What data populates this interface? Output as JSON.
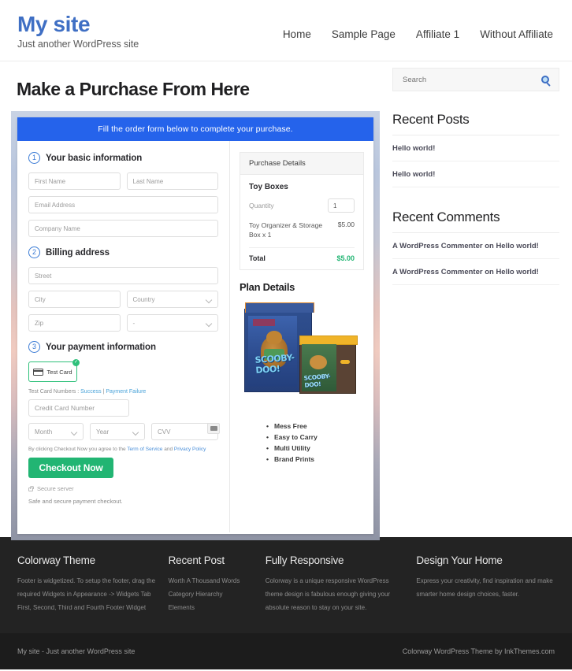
{
  "header": {
    "site_title": "My site",
    "tagline": "Just another WordPress site",
    "nav": [
      {
        "label": "Home"
      },
      {
        "label": "Sample Page"
      },
      {
        "label": "Affiliate 1"
      },
      {
        "label": "Without Affiliate"
      }
    ]
  },
  "main": {
    "page_title": "Make a Purchase From Here",
    "form_banner": "Fill the order form below to complete your purchase.",
    "steps": {
      "basic": {
        "num": "1",
        "label": "Your basic information"
      },
      "billing": {
        "num": "2",
        "label": "Billing address"
      },
      "payment": {
        "num": "3",
        "label": "Your payment information"
      }
    },
    "fields": {
      "first_name": "First Name",
      "last_name": "Last Name",
      "email": "Email Address",
      "company": "Company Name",
      "street": "Street",
      "city": "City",
      "country": "Country",
      "zip": "Zip",
      "state": "-",
      "credit_card": "Credit Card Number",
      "month": "Month",
      "year": "Year",
      "cvv": "CVV"
    },
    "payment_method": {
      "label": "Test Card",
      "check_glyph": "✓"
    },
    "test_card": {
      "prefix": "Test Card Numbers : ",
      "success": "Success",
      "separator": " | ",
      "failure": "Payment Failure"
    },
    "terms": {
      "prefix": "By clicking Checkout Now you agree to the ",
      "tos": "Term of Service",
      "middle": " and ",
      "privacy": "Privacy Policy"
    },
    "checkout_button": "Checkout Now",
    "secure_server": "Secure server",
    "safe_text": "Safe and secure payment checkout."
  },
  "purchase": {
    "panel_title": "Purchase Details",
    "product_name": "Toy Boxes",
    "quantity_label": "Quantity",
    "quantity_value": "1",
    "line_item_name": "Toy Organizer & Storage Box x 1",
    "line_item_price": "$5.00",
    "total_label": "Total",
    "total_value": "$5.00",
    "plan_title": "Plan Details",
    "product_brand": "SCOOBY-DOO!",
    "features": [
      "Mess Free",
      "Easy to Carry",
      "Multi Utility",
      "Brand Prints"
    ]
  },
  "sidebar": {
    "search_placeholder": "Search",
    "recent_posts_title": "Recent Posts",
    "recent_posts": [
      "Hello world!",
      "Hello world!"
    ],
    "recent_comments_title": "Recent Comments",
    "recent_comments": [
      "A WordPress Commenter on Hello world!",
      "A WordPress Commenter on Hello world!"
    ]
  },
  "footer": {
    "columns": [
      {
        "title": "Colorway Theme",
        "text": "Footer is widgetized. To setup the footer, drag the required Widgets in Appearance -> Widgets Tab First, Second, Third and Fourth Footer Widget"
      },
      {
        "title": "Recent Post",
        "items": [
          "Worth A Thousand Words",
          "Category Hierarchy",
          "Elements"
        ]
      },
      {
        "title": "Fully Responsive",
        "text": "Colorway is a unique responsive WordPress theme design is fabulous enough giving your absolute reason to stay on your site."
      },
      {
        "title": "Design Your Home",
        "text": "Express your creativity, find inspiration and make smarter home design choices, faster."
      }
    ],
    "bar_left": "My site - Just another WordPress site",
    "bar_right": "Colorway WordPress Theme by InkThemes.com"
  },
  "colors": {
    "brand_blue": "#3f6fc4",
    "banner_blue": "#2563eb",
    "accent_green": "#22b573",
    "footer_bg": "#232323"
  }
}
